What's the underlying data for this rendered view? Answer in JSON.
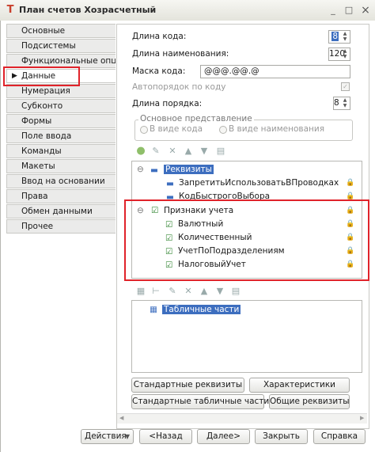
{
  "window": {
    "title": "План счетов Хозрасчетный",
    "minimize": "_",
    "maximize": "□",
    "close": "×"
  },
  "sidebar": {
    "items": [
      {
        "label": "Основные"
      },
      {
        "label": "Подсистемы"
      },
      {
        "label": "Функциональные опции"
      },
      {
        "label": "Данные"
      },
      {
        "label": "Нумерация"
      },
      {
        "label": "Субконто"
      },
      {
        "label": "Формы"
      },
      {
        "label": "Поле ввода"
      },
      {
        "label": "Команды"
      },
      {
        "label": "Макеты"
      },
      {
        "label": "Ввод на основании"
      },
      {
        "label": "Права"
      },
      {
        "label": "Обмен данными"
      },
      {
        "label": "Прочее"
      }
    ],
    "active_marker": "▶"
  },
  "form": {
    "code_length_label": "Длина кода:",
    "code_length_value": "8",
    "name_length_label": "Длина наименования:",
    "name_length_value": "120",
    "code_mask_label": "Маска кода:",
    "code_mask_value": "@@@.@@.@",
    "auto_order_label": "Автопорядок по коду",
    "order_length_label": "Длина порядка:",
    "order_length_value": "8",
    "main_view_group": "Основное представление",
    "view_as_code": "В виде кода",
    "view_as_name": "В виде наименования"
  },
  "attributes_tree": {
    "root": "Реквизиты",
    "children": [
      "ЗапретитьИспользоватьВПроводках",
      "КодБыстрогоВыбора"
    ],
    "accounting_root": "Признаки учета",
    "accounting_children": [
      "Валютный",
      "Количественный",
      "УчетПоПодразделениям",
      "НалоговыйУчет"
    ]
  },
  "tabular_tree": {
    "root": "Табличные части"
  },
  "buttons": {
    "standard_attributes": "Стандартные реквизиты",
    "characteristics": "Характеристики",
    "standard_tabular": "Стандартные табличные части",
    "common_attributes": "Общие реквизиты"
  },
  "footer": {
    "actions": "Действия",
    "back": "<Назад",
    "next": "Далее>",
    "close": "Закрыть",
    "help": "Справка"
  },
  "colors": {
    "highlight_box": "#e0232a",
    "selection": "#3d6ebf"
  }
}
